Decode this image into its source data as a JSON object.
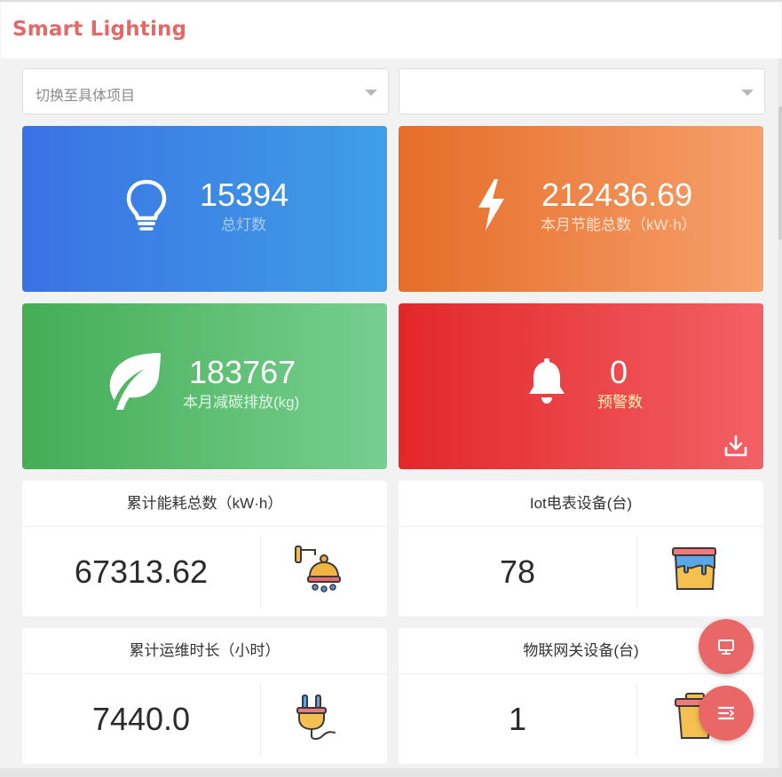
{
  "app": {
    "title": "Smart Lighting"
  },
  "filters": {
    "project_placeholder": "切换至具体项目",
    "second_value": ""
  },
  "stats": {
    "lamps": {
      "value": "15394",
      "label": "总灯数",
      "icon": "lightbulb-icon"
    },
    "energy_saved": {
      "value": "212436.69",
      "label": "本月节能总数（kW·h）",
      "icon": "lightning-icon"
    },
    "carbon": {
      "value": "183767",
      "label": "本月减碳排放(kg)",
      "icon": "leaf-icon"
    },
    "alerts": {
      "value": "0",
      "label": "预警数",
      "icon": "bell-icon"
    }
  },
  "panels": {
    "energy_total": {
      "title": "累计能耗总数（kW·h）",
      "value": "67313.62",
      "icon": "ceiling-lamp-icon"
    },
    "meters": {
      "title": "Iot电表设备(台)",
      "value": "78",
      "icon": "paint-bucket-icon"
    },
    "runtime": {
      "title": "累计运维时长（小时）",
      "value": "7440.0",
      "icon": "power-plug-icon"
    },
    "gateways": {
      "title": "物联网关设备(台)",
      "value": "1",
      "icon": "trash-bin-icon"
    }
  },
  "colors": {
    "brand": "#e06a6a",
    "fab": "#ea6767",
    "blue": "#3a72e4",
    "orange": "#e66d28",
    "green": "#44ad55",
    "red": "#e3272a"
  }
}
